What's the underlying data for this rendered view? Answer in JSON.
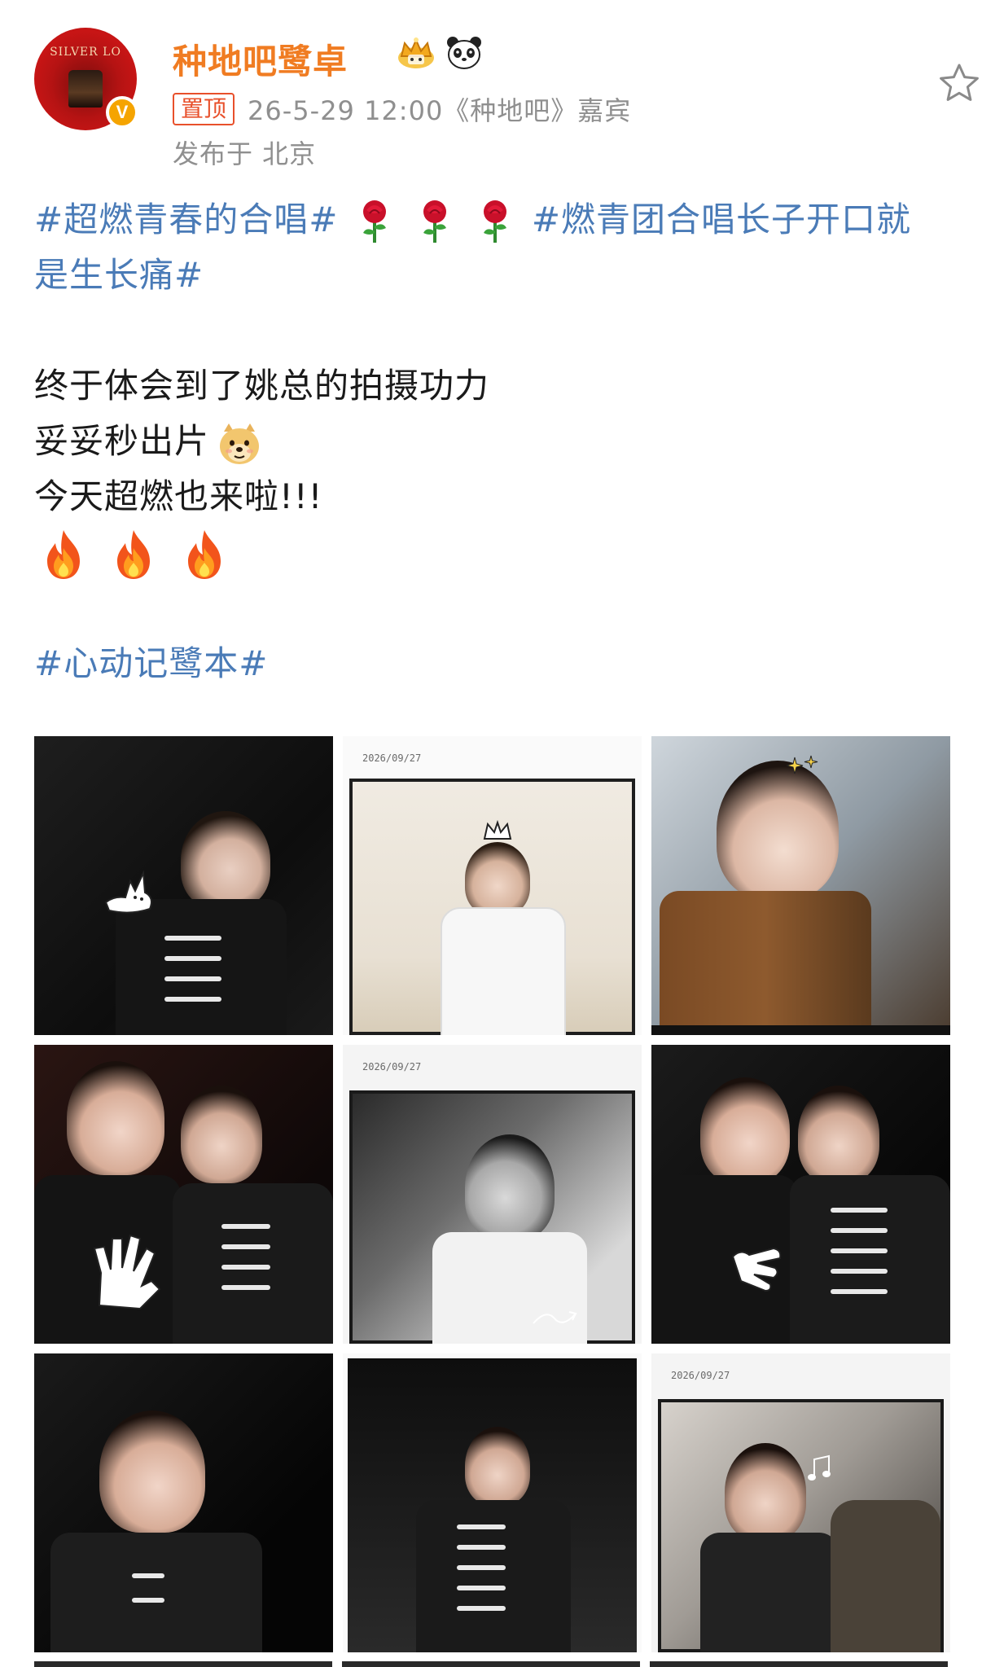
{
  "post": {
    "username": "种地吧鹭卓",
    "avatar_text": "SILVER LO",
    "verified_mark": "V",
    "pin_label": "置顶",
    "meta": "26-5-29 12:00《种地吧》嘉宾",
    "location": "发布于 北京",
    "body": {
      "hashtag_1": "#超燃青春的合唱#",
      "hashtag_2a": "#燃青团合唱长子开口就",
      "hashtag_2b": "是生长痛#",
      "line_1": "终于体会到了姚总的拍摄功力",
      "line_2": "妥妥秒出片",
      "line_3": "今天超燃也来啦!!!",
      "hashtag_3": "#心动记鹭本#"
    },
    "photos": [
      {
        "stamp": ""
      },
      {
        "stamp": "2026/09/27"
      },
      {
        "stamp": ""
      },
      {
        "stamp": ""
      },
      {
        "stamp": "2026/09/27"
      },
      {
        "stamp": ""
      },
      {
        "stamp": ""
      },
      {
        "stamp": ""
      },
      {
        "stamp": "2026/09/27"
      }
    ]
  },
  "icons": {
    "star": "star-outline",
    "badge_1": "crown",
    "badge_2": "panda",
    "emoji_rose": "rose",
    "emoji_doge": "doge",
    "emoji_fire": "fire"
  },
  "colors": {
    "username": "#f07c22",
    "hashtag": "#4a7bb7",
    "meta": "#8f8f8f",
    "pin": "#e8502b",
    "verified": "#f5a400"
  }
}
